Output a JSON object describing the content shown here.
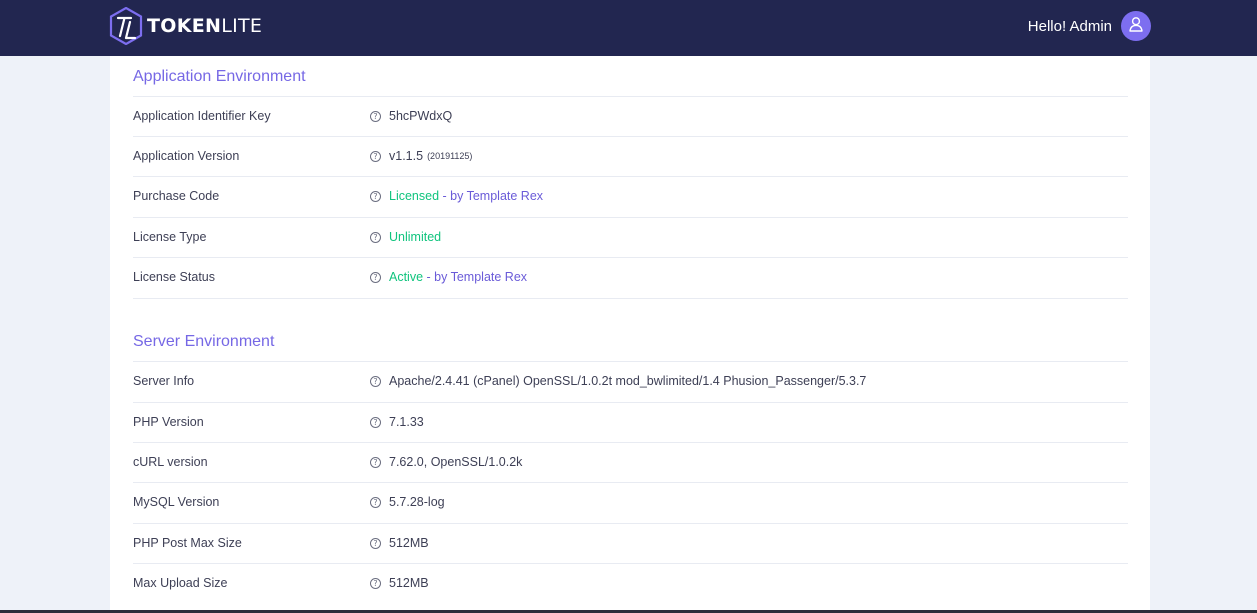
{
  "header": {
    "logo_bold": "TOKEN",
    "logo_light": "LITE",
    "greeting": "Hello! Admin",
    "avatar_icon": "user-icon",
    "logo_icon": "tokenlite-logo-icon"
  },
  "colors": {
    "topbar": "#222650",
    "accent": "#7668e5",
    "success": "#10c47e"
  },
  "application": {
    "title": "Application Environment",
    "rows": [
      {
        "label": "Application Identifier Key",
        "value": "5hcPWdxQ"
      },
      {
        "label": "Application Version",
        "value": "v1.1.5",
        "extra": "(20191125)"
      },
      {
        "label": "Purchase Code",
        "value": "Licensed",
        "suffix": " - by Template Rex"
      },
      {
        "label": "License Type",
        "value": "Unlimited"
      },
      {
        "label": "License Status",
        "value": "Active",
        "suffix": " - by Template Rex"
      }
    ]
  },
  "server": {
    "title": "Server Environment",
    "rows": [
      {
        "label": "Server Info",
        "value": "Apache/2.4.41 (cPanel) OpenSSL/1.0.2t mod_bwlimited/1.4 Phusion_Passenger/5.3.7"
      },
      {
        "label": "PHP Version",
        "value": "7.1.33"
      },
      {
        "label": "cURL version",
        "value": "7.62.0, OpenSSL/1.0.2k"
      },
      {
        "label": "MySQL Version",
        "value": "5.7.28-log"
      },
      {
        "label": "PHP Post Max Size",
        "value": "512MB"
      },
      {
        "label": "Max Upload Size",
        "value": "512MB"
      }
    ]
  },
  "help_icon": "question-circle-icon"
}
